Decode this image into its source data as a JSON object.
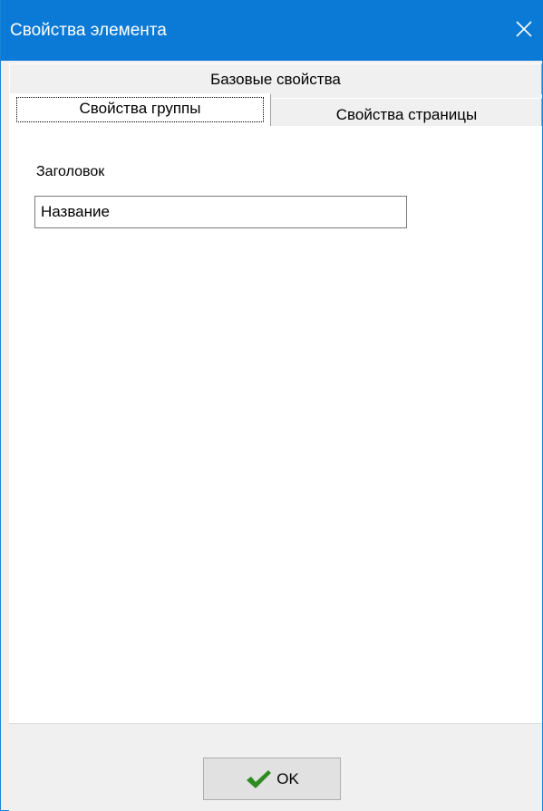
{
  "window": {
    "title": "Свойства элемента",
    "titlebar_color": "#0a7ad6",
    "close_icon": "close-icon"
  },
  "tabs": {
    "base": {
      "label": "Базовые свойства"
    },
    "group": {
      "label": "Свойства группы",
      "selected": true
    },
    "page": {
      "label": "Свойства страницы"
    }
  },
  "form": {
    "header_label": "Заголовок",
    "header_value": "Название"
  },
  "footer": {
    "ok_label": "OK",
    "ok_icon": "check-icon",
    "check_color": "#2e8b1f"
  }
}
